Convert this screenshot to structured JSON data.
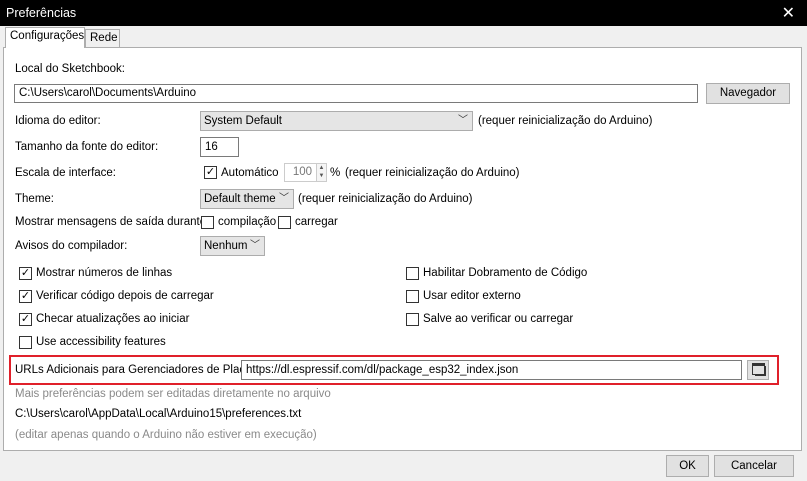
{
  "window": {
    "title": "Preferências",
    "close_glyph": "✕"
  },
  "tabs": [
    {
      "label": "Configurações"
    },
    {
      "label": "Rede"
    }
  ],
  "sketchbook": {
    "label": "Local do Sketchbook:",
    "value": "C:\\Users\\carol\\Documents\\Arduino",
    "browse_label": "Navegador"
  },
  "editor_language": {
    "label": "Idioma do editor:",
    "value": "System Default",
    "note": "(requer reinicialização do Arduino)"
  },
  "font_size": {
    "label": "Tamanho da fonte do editor:",
    "value": "16"
  },
  "interface_scale": {
    "label": "Escala de interface:",
    "auto_label": "Automático",
    "auto_checked": true,
    "value": "100",
    "unit": "%",
    "note": "(requer reinicialização do Arduino)"
  },
  "theme": {
    "label": "Theme:",
    "value": "Default theme",
    "note": "(requer reinicialização do Arduino)"
  },
  "verbose_output": {
    "label": "Mostrar mensagens de saída durante:",
    "compile_label": "compilação",
    "compile_checked": false,
    "upload_label": "carregar",
    "upload_checked": false
  },
  "compiler_warnings": {
    "label": "Avisos do compilador:",
    "value": "Nenhum"
  },
  "options_left": [
    {
      "label": "Mostrar números de linhas",
      "checked": true
    },
    {
      "label": "Verificar código depois de carregar",
      "checked": true
    },
    {
      "label": "Checar atualizações ao iniciar",
      "checked": true
    },
    {
      "label": "Use accessibility features",
      "checked": false
    }
  ],
  "options_right": [
    {
      "label": "Habilitar Dobramento de Código",
      "checked": false
    },
    {
      "label": "Usar editor externo",
      "checked": false
    },
    {
      "label": "Salve ao verificar ou carregar",
      "checked": false
    }
  ],
  "board_urls": {
    "label": "URLs Adicionais para Gerenciadores de Placas:",
    "value": "https://dl.espressif.com/dl/package_esp32_index.json",
    "highlight_color": "#e0202a"
  },
  "info": {
    "line1": "Mais preferências podem ser editadas diretamente no arquivo",
    "path": "C:\\Users\\carol\\AppData\\Local\\Arduino15\\preferences.txt",
    "line3": "(editar apenas quando o Arduino não estiver em execução)"
  },
  "buttons": {
    "ok": "OK",
    "cancel": "Cancelar"
  }
}
